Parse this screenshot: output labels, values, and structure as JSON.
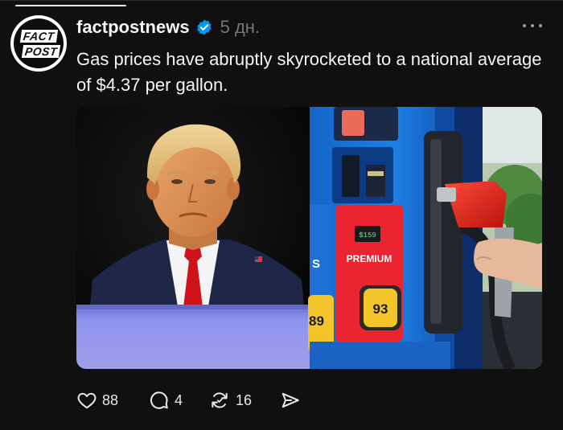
{
  "post": {
    "author": "factpostnews",
    "timestamp": "5 дн.",
    "text": "Gas prices have abruptly skyrocketed to a national average of $4.37 per gallon.",
    "avatar": {
      "line1": "FACT",
      "line2": "POST"
    },
    "verified_icon": "verified-badge-icon",
    "more_icon": "more-horizontal-icon"
  },
  "media": {
    "left_panel": "portrait-photo",
    "right_panel": "gas-pump-photo",
    "pump_display": "$159",
    "pump_grade_label": "PREMIUM",
    "pump_grade_left": "S",
    "octane_left": "89",
    "octane_right": "93"
  },
  "actions": {
    "likes": "88",
    "replies": "4",
    "reposts": "16",
    "like_icon": "heart-icon",
    "reply_icon": "comment-icon",
    "repost_icon": "repost-icon",
    "share_icon": "send-icon"
  },
  "colors": {
    "background": "#101010",
    "text": "#f3f5f7",
    "muted": "#777777",
    "verified": "#0095f6"
  }
}
